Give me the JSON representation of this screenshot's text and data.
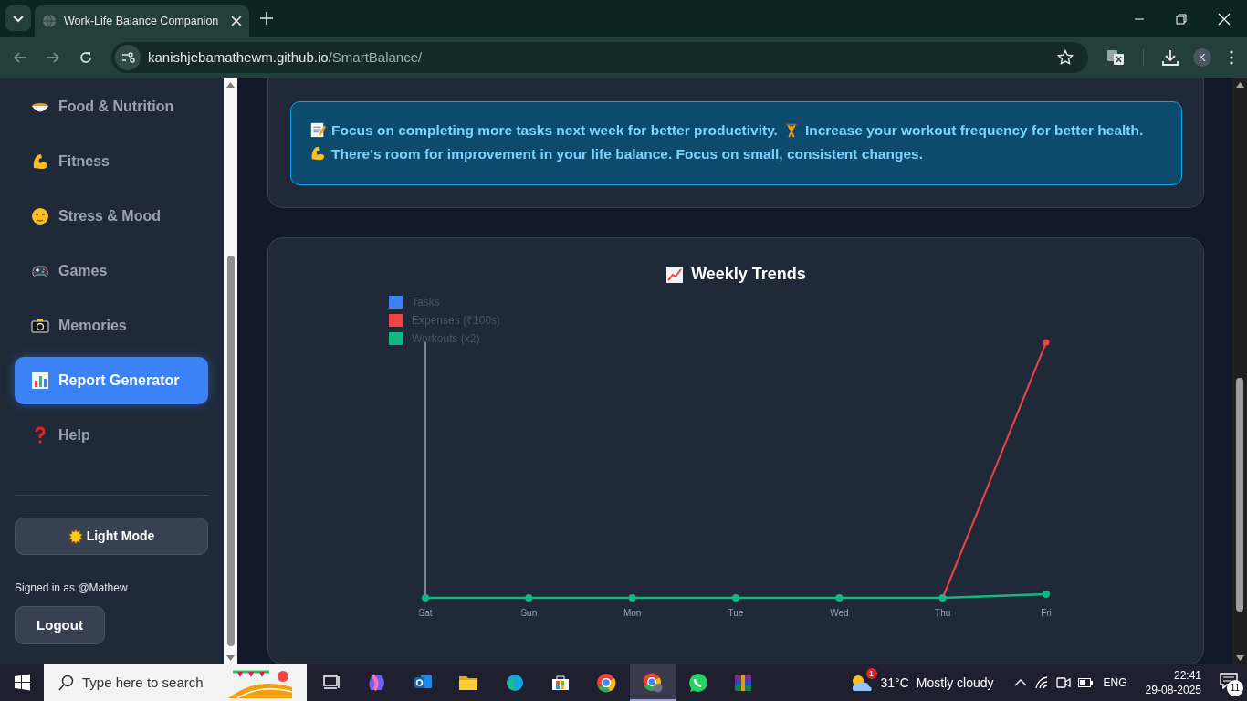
{
  "browser": {
    "tab_title": "Work-Life Balance Companion",
    "url_host": "kanishjebamathewm.github.io",
    "url_path": "/SmartBalance/",
    "profile_initial": "K"
  },
  "sidebar": {
    "items": [
      {
        "label": "Food & Nutrition",
        "kind": "bowl",
        "selected": false
      },
      {
        "label": "Fitness",
        "kind": "arm",
        "selected": false
      },
      {
        "label": "Stress & Mood",
        "kind": "face",
        "selected": false
      },
      {
        "label": "Games",
        "kind": "gamepad",
        "selected": false
      },
      {
        "label": "Memories",
        "kind": "camera",
        "selected": false
      },
      {
        "label": "Report Generator",
        "kind": "chart",
        "selected": true
      },
      {
        "label": "Help",
        "kind": "question",
        "selected": false
      }
    ],
    "theme_button": "Light Mode",
    "signed_in": "Signed in as @Mathew",
    "logout": "Logout"
  },
  "insights": [
    {
      "kind": "memo",
      "text": "Focus on completing more tasks next week for better productivity."
    },
    {
      "kind": "weights",
      "text": "Increase your workout frequency for better health."
    },
    {
      "kind": "arm",
      "text": "There's room for improvement in your life balance. Focus on small, consistent changes."
    }
  ],
  "trends": {
    "title": "Weekly Trends",
    "legend": [
      {
        "label": "Tasks",
        "color": "#3b82f6"
      },
      {
        "label": "Expenses (₹100s)",
        "color": "#ef4444"
      },
      {
        "label": "Workouts (x2)",
        "color": "#10b981"
      }
    ],
    "days": [
      "Sat",
      "Sun",
      "Mon",
      "Tue",
      "Wed",
      "Thu",
      "Fri"
    ]
  },
  "taskbar": {
    "search_placeholder": "Type here to search",
    "weather_badge": "1",
    "temperature": "31°C",
    "weather": "Mostly cloudy",
    "language": "ENG",
    "time": "22:41",
    "date": "29-08-2025",
    "notifications": "11"
  }
}
